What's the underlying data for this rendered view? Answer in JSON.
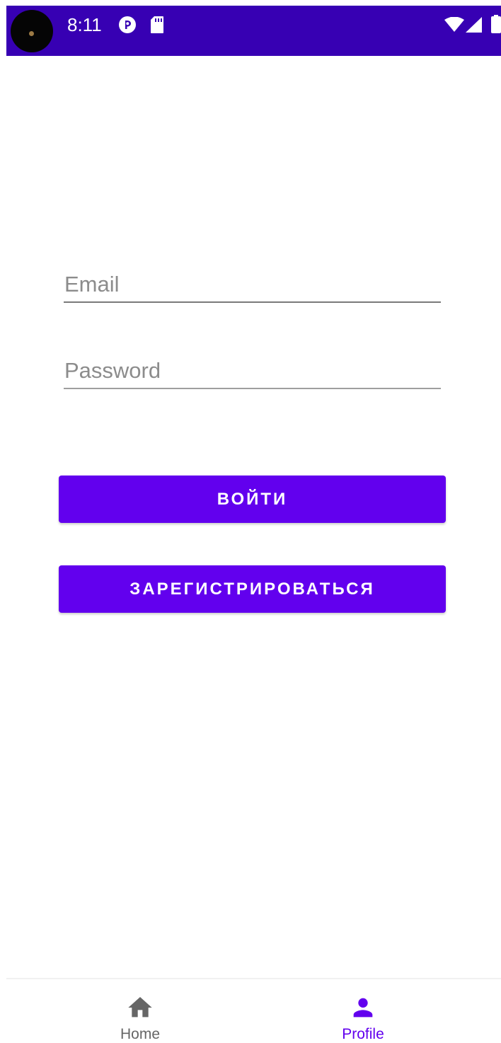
{
  "status_bar": {
    "time": "8:11",
    "background_color": "#3700b3",
    "icons": [
      "camera-cutout-icon",
      "pocket-casts-icon",
      "sd-card-icon",
      "wifi-icon",
      "signal-icon",
      "battery-icon"
    ]
  },
  "form": {
    "email_placeholder": "Email",
    "email_value": "",
    "password_placeholder": "Password",
    "password_value": ""
  },
  "buttons": {
    "login_label": "ВОЙТИ",
    "register_label": "ЗАРЕГИСТРИРОВАТЬСЯ",
    "color": "#6200ee"
  },
  "bottom_nav": {
    "active": "profile",
    "active_color": "#6200ee",
    "items": [
      {
        "label": "Home",
        "icon": "home-icon"
      },
      {
        "label": "Profile",
        "icon": "person-icon"
      }
    ]
  }
}
